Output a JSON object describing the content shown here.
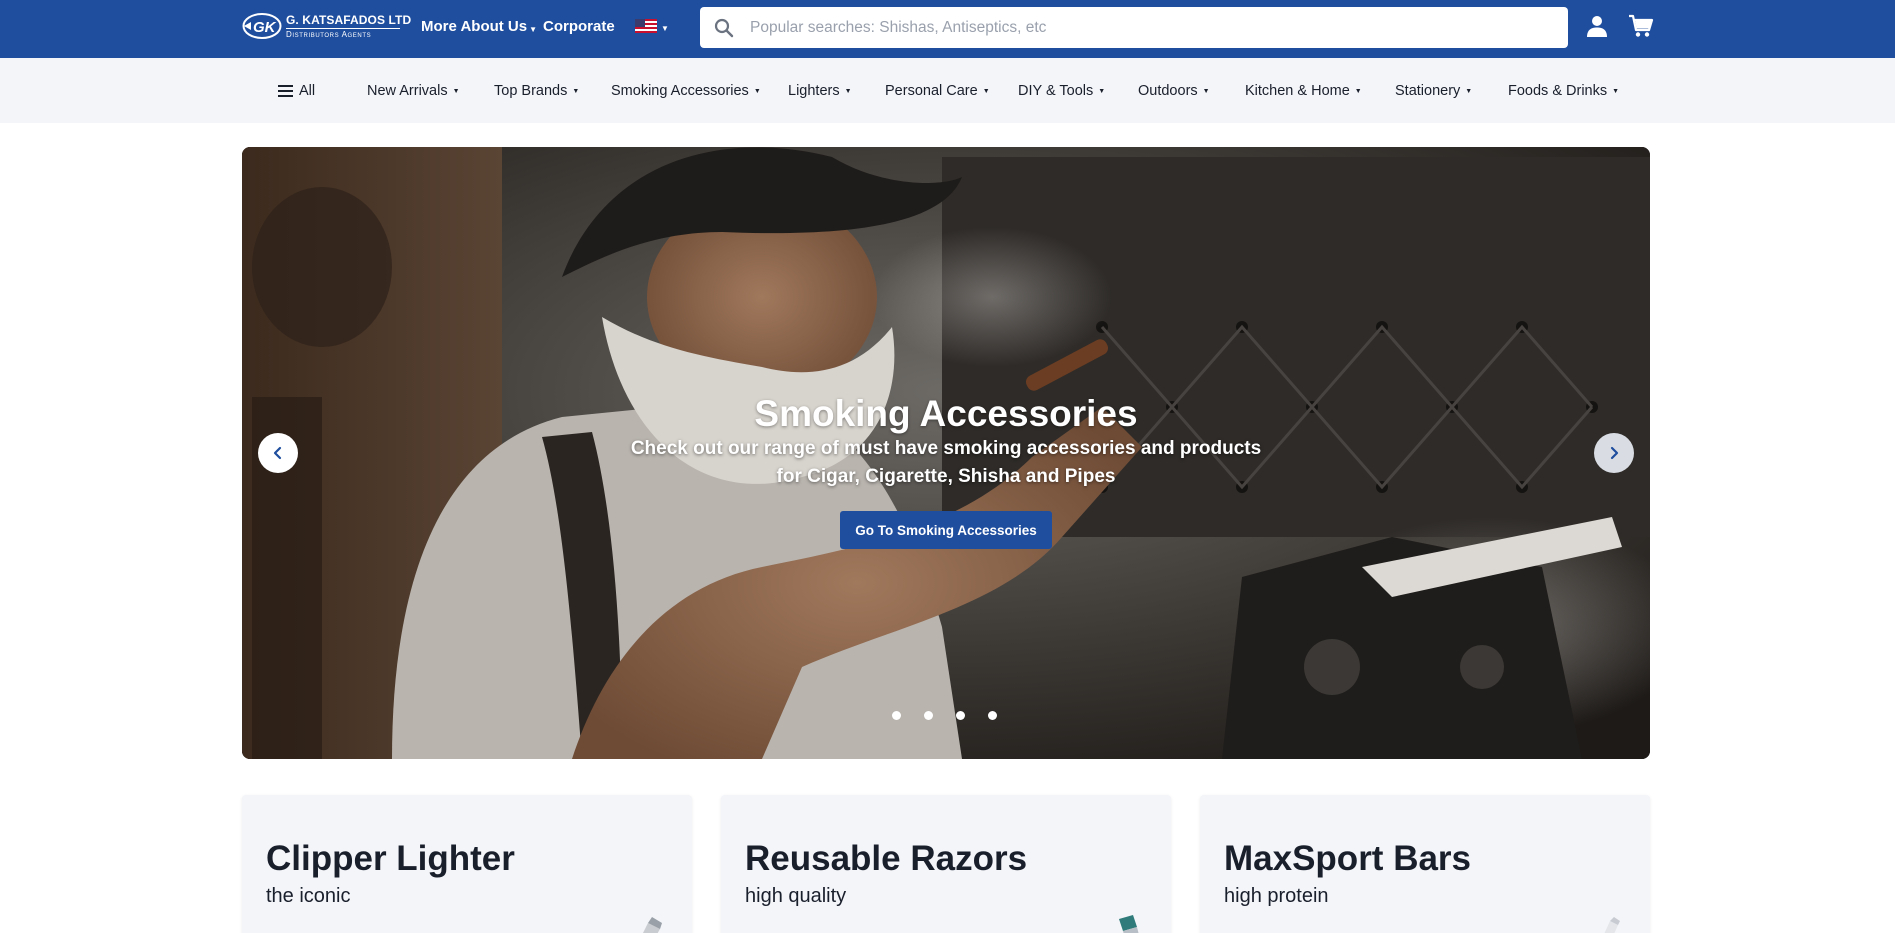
{
  "header": {
    "logo": {
      "name": "G. KATSAFADOS LTD",
      "tagline": "Distributors Agents",
      "mark": "GK"
    },
    "links": [
      {
        "label": "More About Us",
        "has_dropdown": true
      },
      {
        "label": "Corporate",
        "has_dropdown": false
      }
    ],
    "language_flag": "us-flag-icon",
    "search": {
      "placeholder": "Popular searches: Shishas, Antiseptics, etc",
      "value": ""
    },
    "icons": [
      "search-icon",
      "user-icon",
      "cart-icon"
    ],
    "brand_color": "#1f4e9f"
  },
  "nav": {
    "all_label": "All",
    "categories": [
      {
        "label": "New Arrivals"
      },
      {
        "label": "Top Brands"
      },
      {
        "label": "Smoking Accessories"
      },
      {
        "label": "Lighters"
      },
      {
        "label": "Personal Care"
      },
      {
        "label": "DIY & Tools"
      },
      {
        "label": "Outdoors"
      },
      {
        "label": "Kitchen & Home"
      },
      {
        "label": "Stationery"
      },
      {
        "label": "Foods & Drinks"
      }
    ]
  },
  "hero": {
    "title": "Smoking Accessories",
    "subtitle": "Check out our range of must have smoking accessories and products for Cigar, Cigarette, Shisha and Pipes",
    "cta_label": "Go To Smoking Accessories",
    "slide_count": 4,
    "active_slide": 1,
    "prev_icon": "chevron-left-icon",
    "next_icon": "chevron-right-icon"
  },
  "promos": [
    {
      "title": "Clipper Lighter",
      "subtitle": "the iconic"
    },
    {
      "title": "Reusable Razors",
      "subtitle": "high quality"
    },
    {
      "title": "MaxSport Bars",
      "subtitle": "high protein"
    }
  ]
}
